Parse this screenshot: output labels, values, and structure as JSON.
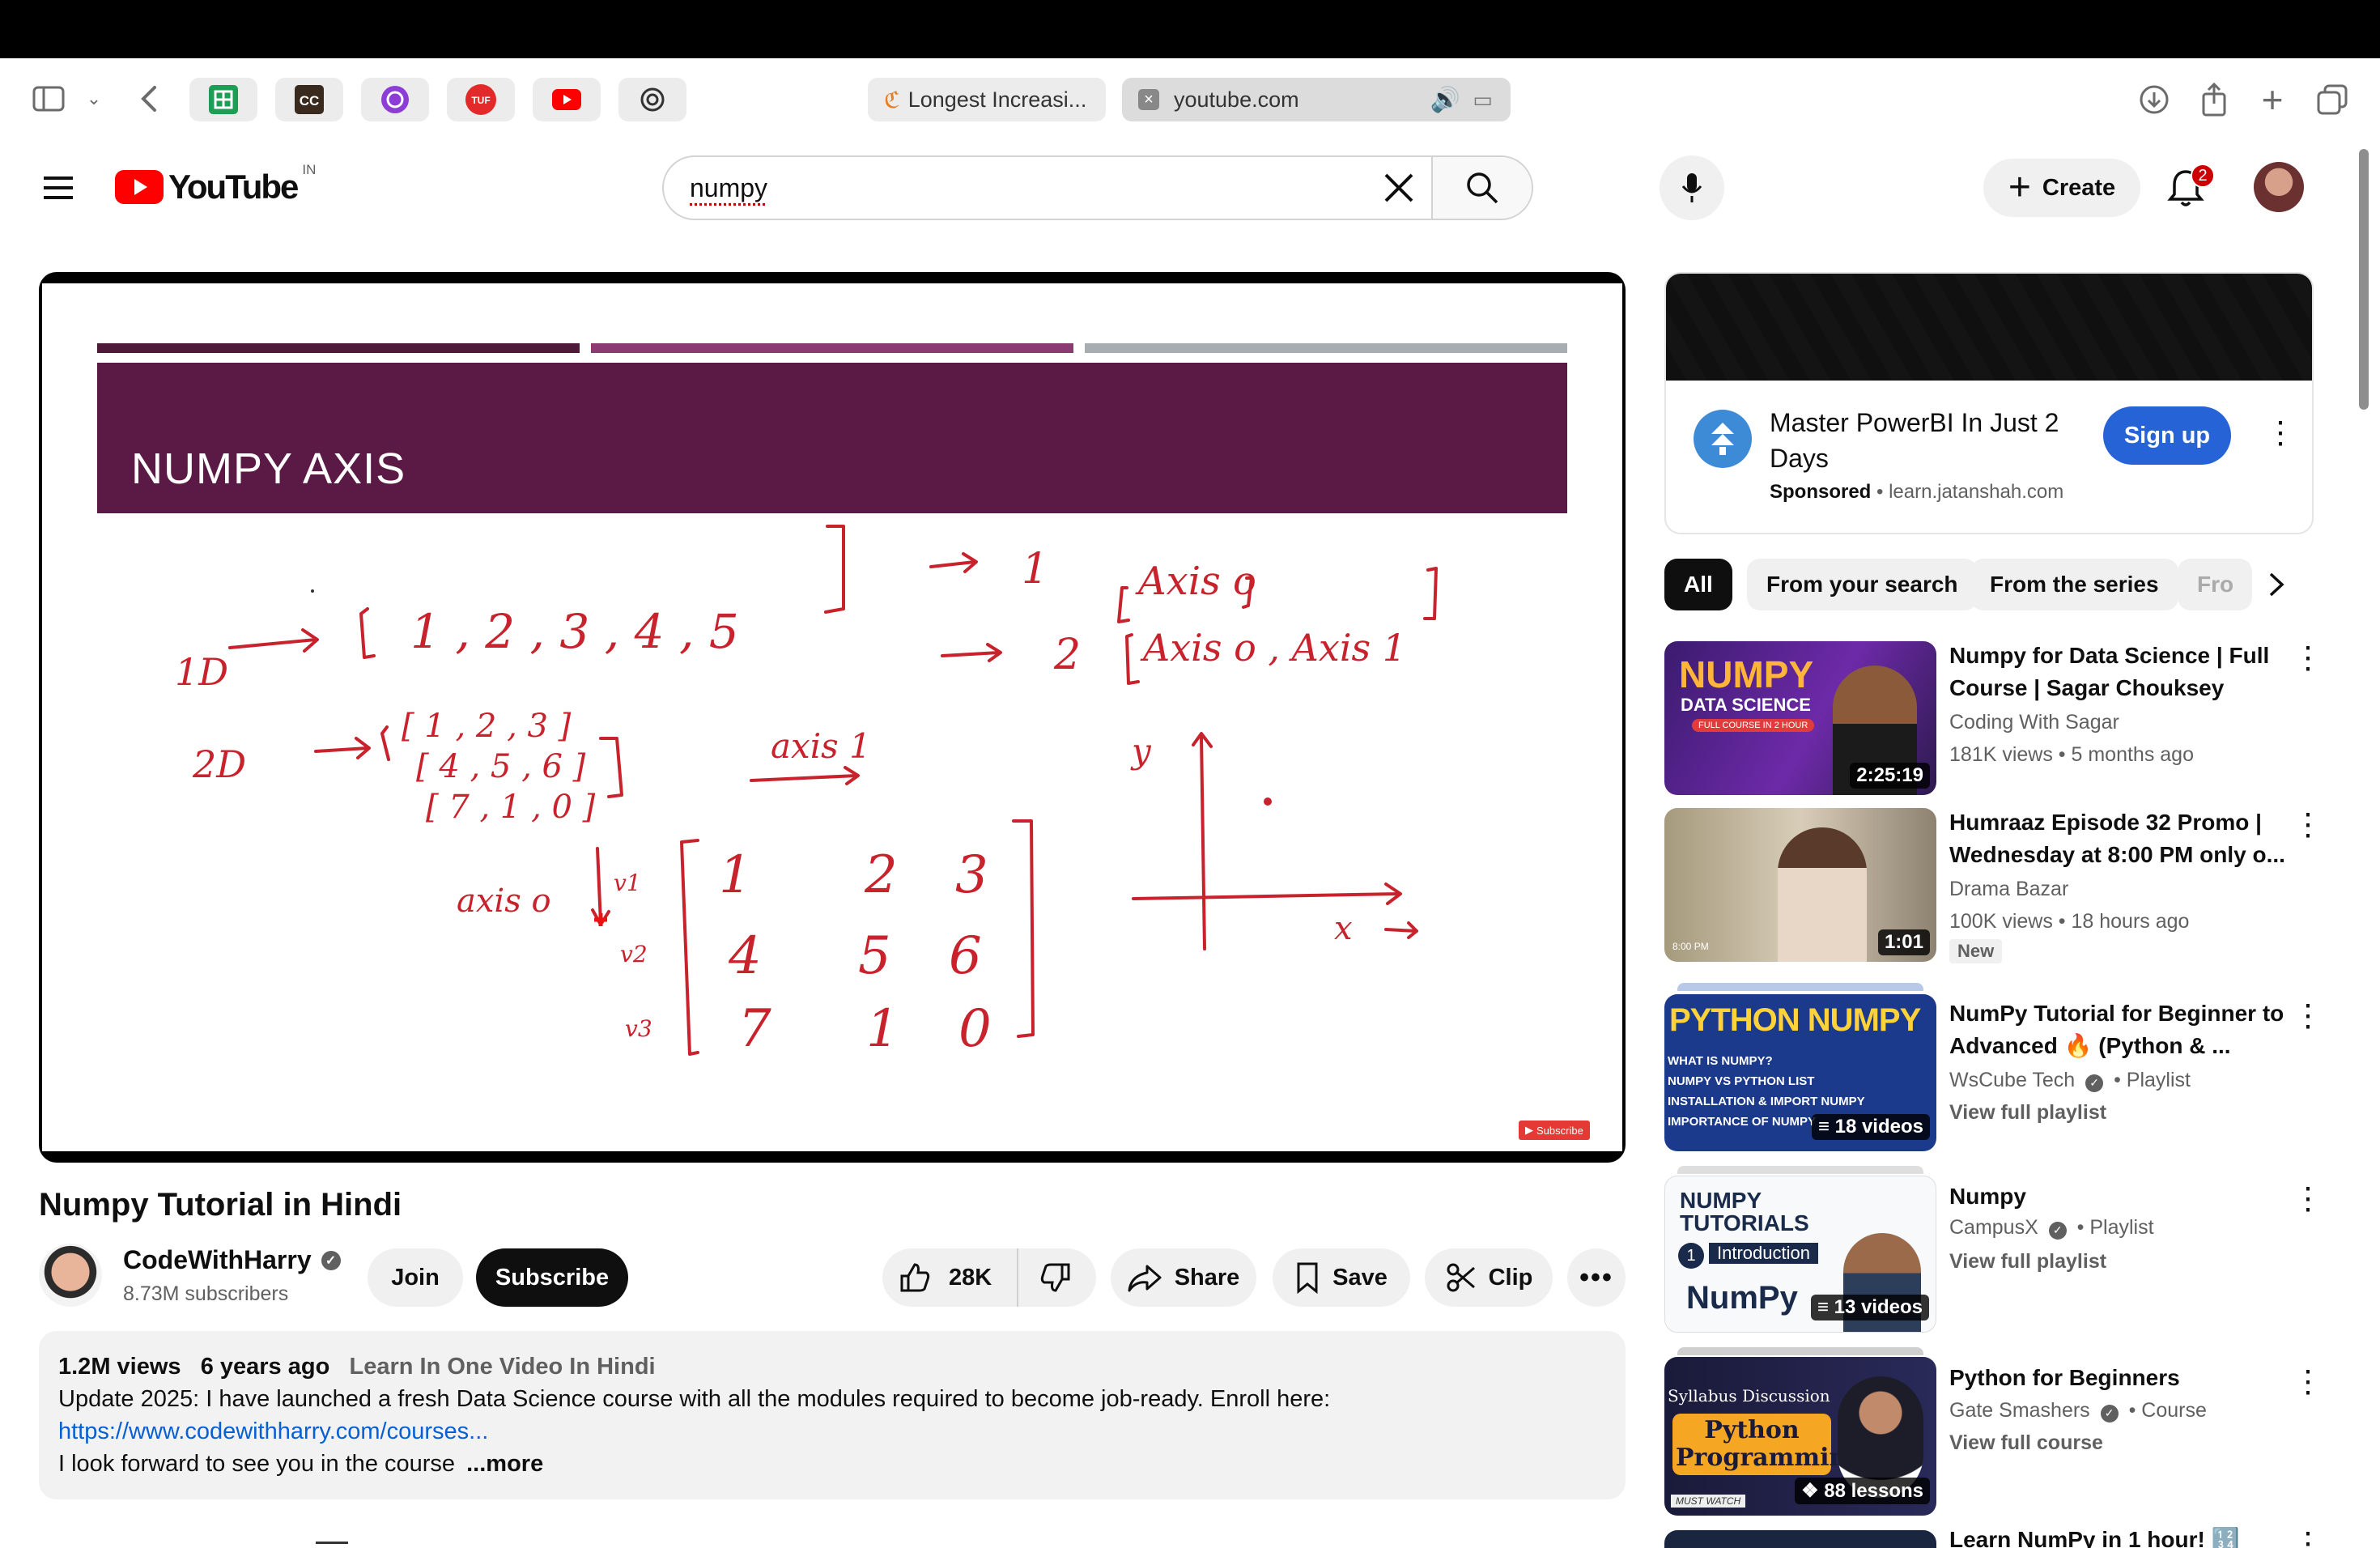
{
  "browser": {
    "tabs": [
      {
        "label": "Longest Increasi..."
      },
      {
        "label": "youtube.com"
      }
    ]
  },
  "masthead": {
    "logo_text": "YouTube",
    "country": "IN",
    "search_value": "numpy",
    "create_label": "Create",
    "notification_count": "2"
  },
  "video": {
    "slide_title": "NUMPY AXIS",
    "subscribe_watermark": "Subscribe",
    "title": "Numpy Tutorial in Hindi",
    "channel": "CodeWithHarry",
    "subscribers": "8.73M subscribers",
    "join_label": "Join",
    "subscribe_label": "Subscribe",
    "likes": "28K",
    "share_label": "Share",
    "save_label": "Save",
    "clip_label": "Clip"
  },
  "description": {
    "views": "1.2M views",
    "age": "6 years ago",
    "tags": "Learn In One Video In Hindi",
    "line1": "Update 2025: I have launched a fresh Data Science course with all the modules required to become job-ready. Enroll here:",
    "link": "https://www.codewithharry.com/courses...",
    "line3": "I look forward to see you in the course",
    "more": "...more"
  },
  "ad": {
    "title": "Master PowerBI In Just 2 Days",
    "sponsored": "Sponsored",
    "domain": "learn.jatanshah.com",
    "cta": "Sign up"
  },
  "chips": [
    "All",
    "From your search",
    "From the series",
    "Fro"
  ],
  "recommendations": [
    {
      "title": "Numpy for Data Science | Full Course | Sagar Chouksey",
      "channel": "Coding With Sagar",
      "meta": "181K views • 5 months ago",
      "duration": "2:25:19",
      "thumb_text": "NUMPY",
      "thumb_sub": "DATA SCIENCE",
      "thumb_tag": "FULL COURSE IN 2 HOUR"
    },
    {
      "title": "Humraaz Episode 32 Promo | Wednesday at 8:00 PM only o...",
      "channel": "Drama Bazar",
      "meta": "100K views • 18 hours ago",
      "duration": "1:01",
      "badge": "New",
      "thumb_tag": "8:00 PM"
    },
    {
      "title": "NumPy  Tutorial for Beginner to Advanced 🔥 (Python & ...",
      "channel": "WsCube Tech",
      "kind": "Playlist",
      "meta": "View full playlist",
      "duration": "18 videos",
      "thumb_text": "PYTHON NUMPY",
      "thumb_lines": [
        "WHAT IS NUMPY?",
        "NUMPY VS PYTHON LIST",
        "INSTALLATION & IMPORT NUMPY",
        "IMPORTANCE OF NUMPY"
      ]
    },
    {
      "title": "Numpy",
      "channel": "CampusX",
      "kind": "Playlist",
      "meta": "View full playlist",
      "duration": "13 videos",
      "thumb_text": "NUMPY TUTORIALS",
      "thumb_sub": "Introduction",
      "thumb_num": "1",
      "thumb_tag": "NumPy"
    },
    {
      "title": "Python for Beginners",
      "channel": "Gate Smashers",
      "kind": "Course",
      "meta": "View full course",
      "duration": "88 lessons",
      "thumb_text": "Syllabus Discussion",
      "thumb_sub": "Python Programming",
      "thumb_tag": "MUST WATCH"
    },
    {
      "title": "Learn NumPy in 1 hour! 🔢"
    }
  ],
  "colors": {
    "yt_red": "#ff0000",
    "slide_banner": "#5a1a45",
    "ink": "#c8232c",
    "link": "#065fd4",
    "ad_button": "#065fd4"
  }
}
